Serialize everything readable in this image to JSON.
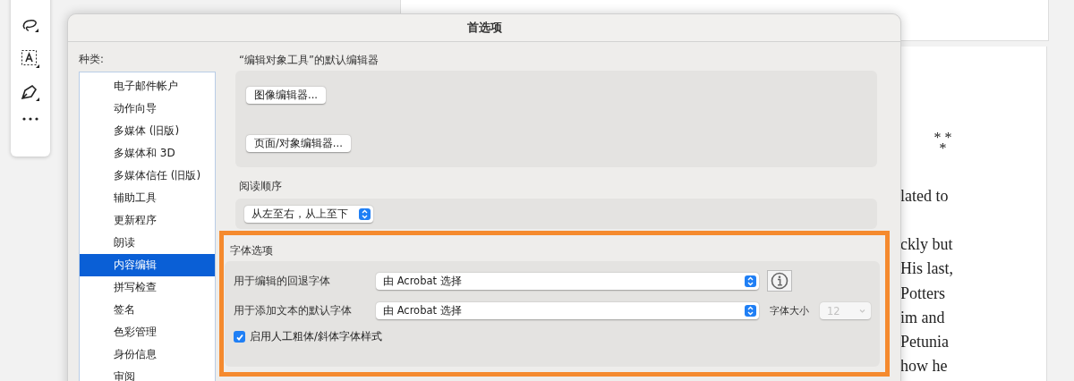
{
  "document": {
    "ornament": [
      "* *",
      "*"
    ],
    "paragraphs": [
      [
        "lated to"
      ],
      [
        "ckly but",
        "His last,",
        "Potters",
        "im and",
        "Petunia",
        "how he"
      ]
    ]
  },
  "window": {
    "title": "首选项"
  },
  "sidebar": {
    "label": "种类:",
    "items": [
      {
        "label": "电子邮件帐户",
        "selected": false
      },
      {
        "label": "动作向导",
        "selected": false
      },
      {
        "label": "多媒体 (旧版)",
        "selected": false
      },
      {
        "label": "多媒体和 3D",
        "selected": false
      },
      {
        "label": "多媒体信任 (旧版)",
        "selected": false
      },
      {
        "label": "辅助工具",
        "selected": false
      },
      {
        "label": "更新程序",
        "selected": false
      },
      {
        "label": "朗读",
        "selected": false
      },
      {
        "label": "内容编辑",
        "selected": true
      },
      {
        "label": "拼写检查",
        "selected": false
      },
      {
        "label": "签名",
        "selected": false
      },
      {
        "label": "色彩管理",
        "selected": false
      },
      {
        "label": "身份信息",
        "selected": false
      },
      {
        "label": "审阅",
        "selected": false
      }
    ]
  },
  "editors": {
    "title": "“编辑对象工具”的默认编辑器",
    "buttons": [
      "图像编辑器...",
      "页面/对象编辑器..."
    ]
  },
  "reading_order": {
    "title": "阅读顺序",
    "value": "从左至右，从上至下"
  },
  "font_options": {
    "title": "字体选项",
    "highlighted": true,
    "fallback": {
      "label": "用于编辑的回退字体",
      "value": "由 Acrobat 选择"
    },
    "default_font": {
      "label": "用于添加文本的默认字体",
      "value": "由 Acrobat 选择"
    },
    "size": {
      "label": "字体大小",
      "value": "12",
      "disabled": true
    },
    "synthetic": {
      "label": "启用人工粗体/斜体字体样式",
      "checked": true
    }
  }
}
